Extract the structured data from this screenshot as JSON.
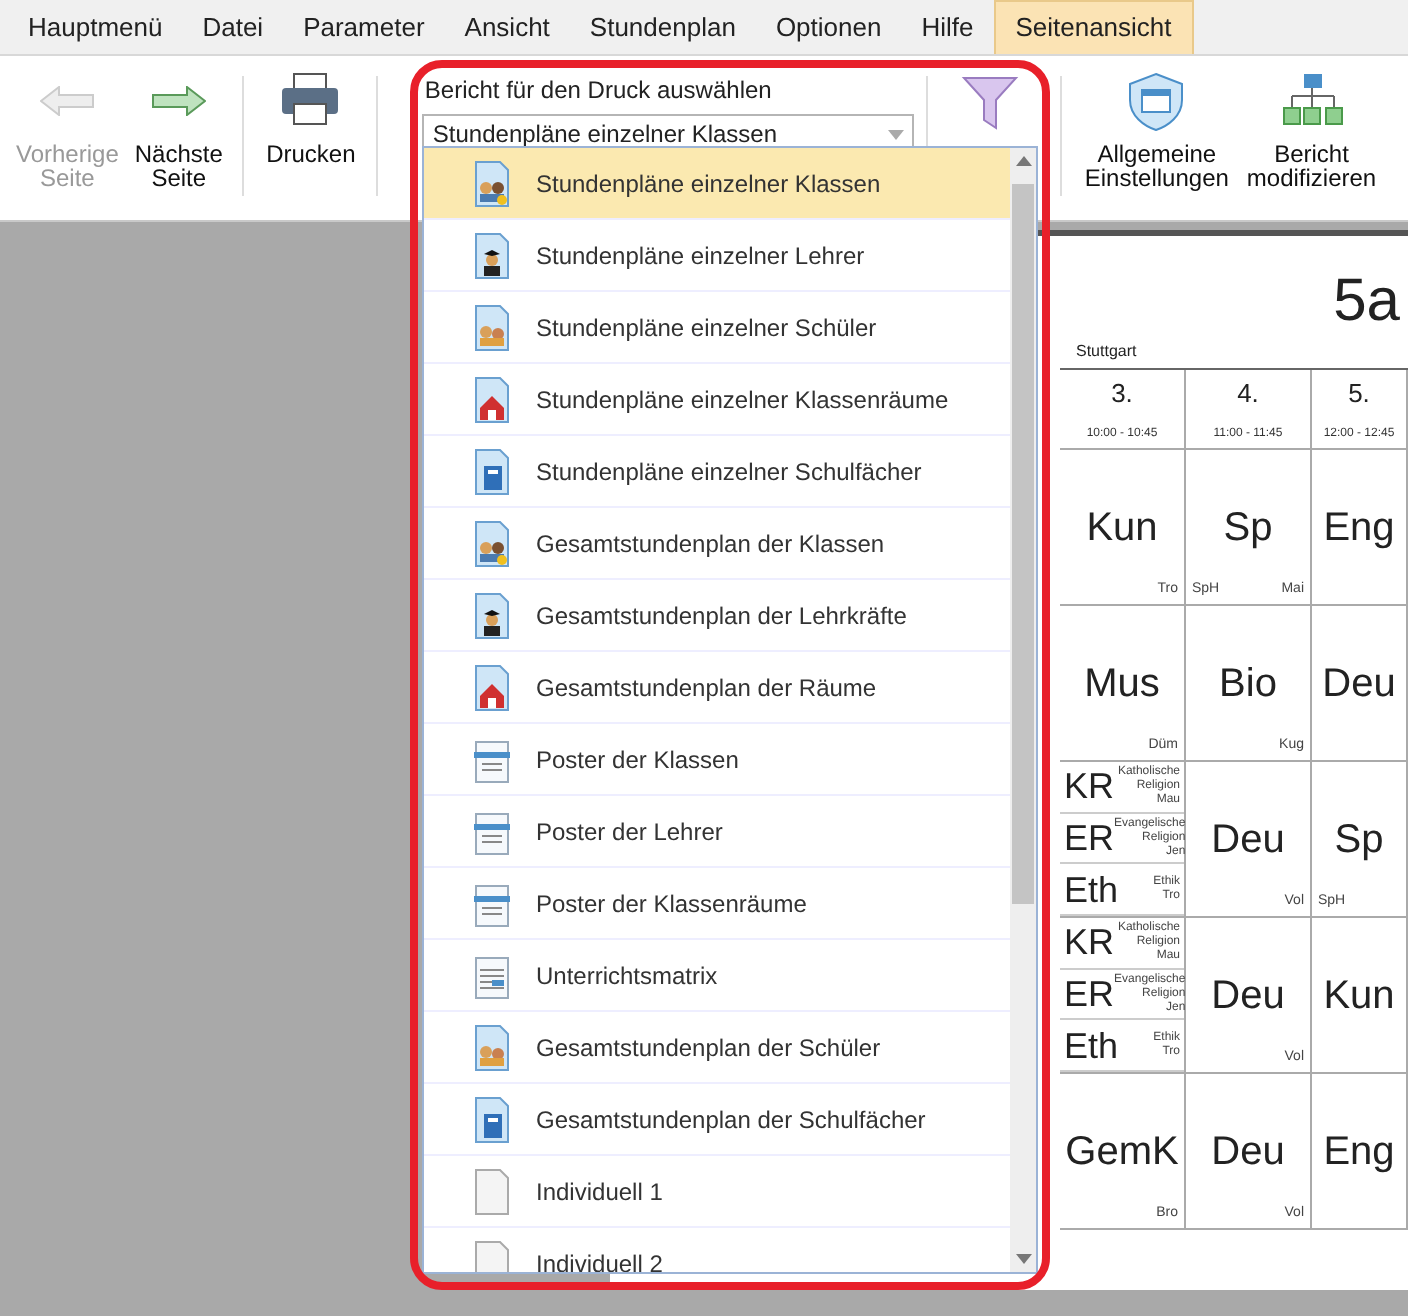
{
  "menu_tabs": [
    {
      "label": "Hauptmenü",
      "selected": false
    },
    {
      "label": "Datei",
      "selected": false
    },
    {
      "label": "Parameter",
      "selected": false
    },
    {
      "label": "Ansicht",
      "selected": false
    },
    {
      "label": "Stundenplan",
      "selected": false
    },
    {
      "label": "Optionen",
      "selected": false
    },
    {
      "label": "Hilfe",
      "selected": false
    },
    {
      "label": "Seitenansicht",
      "selected": true
    }
  ],
  "ribbon": {
    "left_buttons": [
      {
        "kind": "prev",
        "lines": [
          "Vorherige",
          "Seite"
        ],
        "disabled": true
      },
      {
        "kind": "next",
        "lines": [
          "Nächste",
          "Seite"
        ],
        "disabled": false
      },
      {
        "kind": "print",
        "lines": [
          "Drucken"
        ],
        "disabled": false
      }
    ],
    "report_select": {
      "label": "Bericht für den Druck auswählen",
      "value": "Stundenpläne einzelner Klassen"
    },
    "right_buttons": [
      {
        "kind": "settings",
        "lines": [
          "Allgemeine",
          "Einstellungen"
        ],
        "disabled": false
      },
      {
        "kind": "modify",
        "lines": [
          "Bericht",
          "modifizieren"
        ],
        "disabled": false
      }
    ]
  },
  "report_list": [
    {
      "label": "Stundenpläne einzelner Klassen",
      "kind": "classes",
      "selected": true
    },
    {
      "label": "Stundenpläne einzelner Lehrer",
      "kind": "teacher",
      "selected": false
    },
    {
      "label": "Stundenpläne einzelner Schüler",
      "kind": "students",
      "selected": false
    },
    {
      "label": "Stundenpläne einzelner Klassenräume",
      "kind": "room",
      "selected": false
    },
    {
      "label": "Stundenpläne einzelner Schulfächer",
      "kind": "subject",
      "selected": false
    },
    {
      "label": "Gesamtstundenplan der Klassen",
      "kind": "classes",
      "selected": false
    },
    {
      "label": "Gesamtstundenplan der Lehrkräfte",
      "kind": "teacher",
      "selected": false
    },
    {
      "label": "Gesamtstundenplan der Räume",
      "kind": "room",
      "selected": false
    },
    {
      "label": "Poster der Klassen",
      "kind": "poster",
      "selected": false
    },
    {
      "label": "Poster der Lehrer",
      "kind": "poster",
      "selected": false
    },
    {
      "label": "Poster der Klassenräume",
      "kind": "poster",
      "selected": false
    },
    {
      "label": "Unterrichtsmatrix",
      "kind": "matrix",
      "selected": false
    },
    {
      "label": "Gesamtstundenplan der Schüler",
      "kind": "students",
      "selected": false
    },
    {
      "label": "Gesamtstundenplan der Schulfächer",
      "kind": "subject",
      "selected": false
    },
    {
      "label": "Individuell 1",
      "kind": "blank",
      "selected": false
    },
    {
      "label": "Individuell 2",
      "kind": "blank",
      "selected": false
    }
  ],
  "timetable": {
    "school": "Stuttgart",
    "class_name": "5a",
    "periods": [
      {
        "number": "3.",
        "time": "10:00 - 10:45"
      },
      {
        "number": "4.",
        "time": "11:00 - 11:45"
      },
      {
        "number": "5.",
        "time": "12:00 - 12:45"
      }
    ],
    "rows": [
      [
        {
          "kind": "single",
          "subject": "Kun",
          "teacher": "Tro"
        },
        {
          "kind": "single",
          "subject": "Sp",
          "room": "SpH",
          "teacher": "Mai"
        },
        {
          "kind": "single",
          "subject": "Eng"
        }
      ],
      [
        {
          "kind": "single",
          "subject": "Mus",
          "teacher": "Düm"
        },
        {
          "kind": "single",
          "subject": "Bio",
          "teacher": "Kug"
        },
        {
          "kind": "single",
          "subject": "Deu"
        }
      ],
      [
        {
          "kind": "split",
          "lessons": [
            {
              "subject": "KR",
              "name": "Katholische Religion",
              "teacher": "Mau"
            },
            {
              "subject": "ER",
              "name": "Evangelische Religion",
              "teacher": "Jen"
            },
            {
              "subject": "Eth",
              "name": "Ethik",
              "teacher": "Tro"
            }
          ]
        },
        {
          "kind": "single",
          "subject": "Deu",
          "teacher": "Vol"
        },
        {
          "kind": "single",
          "subject": "Sp",
          "room": "SpH"
        }
      ],
      [
        {
          "kind": "split",
          "lessons": [
            {
              "subject": "KR",
              "name": "Katholische Religion",
              "teacher": "Mau"
            },
            {
              "subject": "ER",
              "name": "Evangelische Religion",
              "teacher": "Jen"
            },
            {
              "subject": "Eth",
              "name": "Ethik",
              "teacher": "Tro"
            }
          ]
        },
        {
          "kind": "single",
          "subject": "Deu",
          "teacher": "Vol"
        },
        {
          "kind": "single",
          "subject": "Kun"
        }
      ],
      [
        {
          "kind": "single",
          "subject": "GemK",
          "teacher": "Bro"
        },
        {
          "kind": "single",
          "subject": "Deu",
          "teacher": "Vol"
        },
        {
          "kind": "single",
          "subject": "Eng"
        }
      ]
    ]
  }
}
